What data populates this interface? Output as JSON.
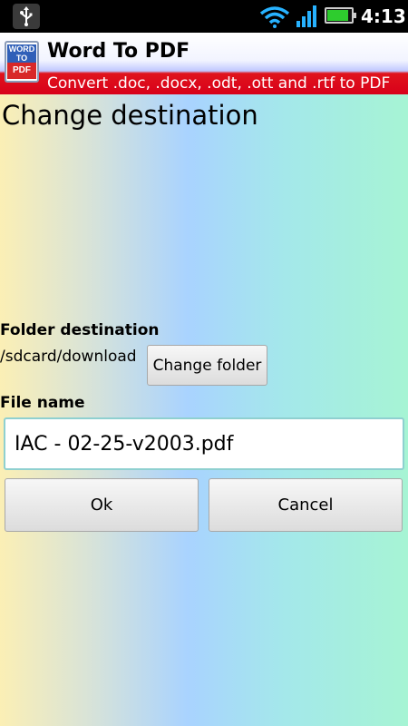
{
  "status_bar": {
    "time": "4:13",
    "icons": [
      "usb-icon",
      "wifi-icon",
      "signal-icon",
      "battery-icon"
    ],
    "battery_level": 0.9,
    "battery_color": "#2ecc2e"
  },
  "app_header": {
    "logo_top_text": "WORD TO",
    "logo_bottom_text": "PDF",
    "title": "Word To PDF",
    "subtitle": "Convert .doc, .docx, .odt, .ott and .rtf to PDF",
    "accent_color": "#d8001a"
  },
  "page": {
    "title": "Change destination"
  },
  "folder": {
    "label": "Folder destination",
    "path": "/sdcard/download",
    "change_button": "Change folder"
  },
  "file": {
    "label": "File name",
    "value": "IAC - 02-25-v2003.pdf"
  },
  "actions": {
    "ok": "Ok",
    "cancel": "Cancel"
  }
}
